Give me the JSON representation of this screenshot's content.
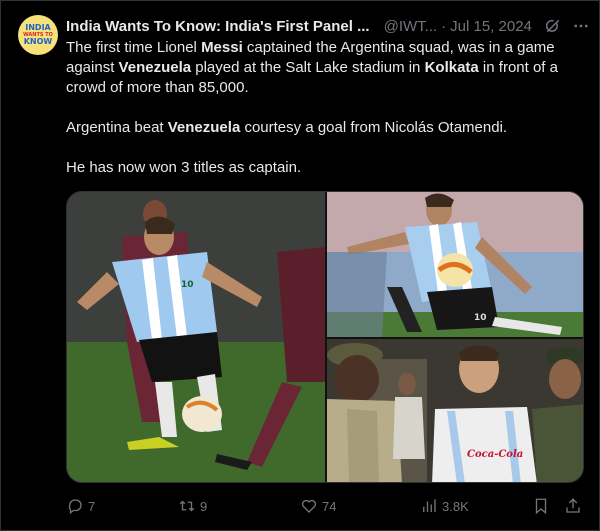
{
  "tweet": {
    "author": {
      "name": "India Wants To Know: India's First Panel ...",
      "handle": "@IWT...",
      "avatar_text": [
        "INDIA",
        "WANTS TO",
        "KNOW"
      ]
    },
    "separator": "·",
    "date": "Jul 15, 2024",
    "paragraphs": [
      [
        {
          "t": "The first time Lionel ",
          "b": false
        },
        {
          "t": "Messi",
          "b": true
        },
        {
          "t": " captained the Argentina squad, was in a game against ",
          "b": false
        },
        {
          "t": "Venezuela",
          "b": true
        },
        {
          "t": " played at the Salt Lake stadium in ",
          "b": false
        },
        {
          "t": "Kolkata",
          "b": true
        },
        {
          "t": " in front of a crowd of more than 85,000.",
          "b": false
        }
      ],
      [
        {
          "t": "Argentina beat ",
          "b": false
        },
        {
          "t": "Venezuela",
          "b": true
        },
        {
          "t": " courtesy a goal from Nicolás Otamendi.",
          "b": false
        }
      ],
      [
        {
          "t": "He has now won 3 titles as captain.",
          "b": false
        }
      ]
    ],
    "media_text": {
      "left_shirt_number": "10",
      "right_top_shirt_number": "10",
      "sponsor": "Coca-Cola"
    },
    "actions": {
      "replies": "7",
      "reposts": "9",
      "likes": "74",
      "views": "3.8K"
    },
    "icons": [
      "grok-icon",
      "more-icon",
      "reply-icon",
      "repost-icon",
      "like-icon",
      "views-icon",
      "bookmark-icon",
      "share-icon"
    ]
  }
}
